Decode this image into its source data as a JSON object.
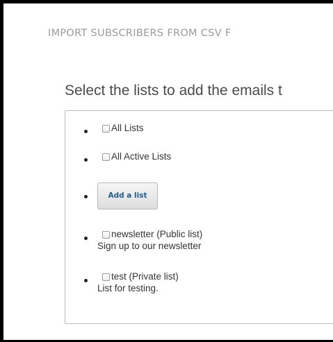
{
  "page": {
    "title": "IMPORT SUBSCRIBERS FROM CSV F"
  },
  "section": {
    "heading": "Select the lists to add the emails t"
  },
  "lists": {
    "all_lists_label": "All Lists",
    "all_active_lists_label": "All Active Lists",
    "add_list_button": "Add a list",
    "items": [
      {
        "label": "newsletter (Public list)",
        "description": "Sign up to our newsletter"
      },
      {
        "label": "test (Private list)",
        "description": "List for testing."
      }
    ]
  },
  "colors": {
    "page_title": "#9a9a9a",
    "heading": "#4a4a4a",
    "button_text": "#1f5f8b",
    "border": "#bdbdbd"
  }
}
